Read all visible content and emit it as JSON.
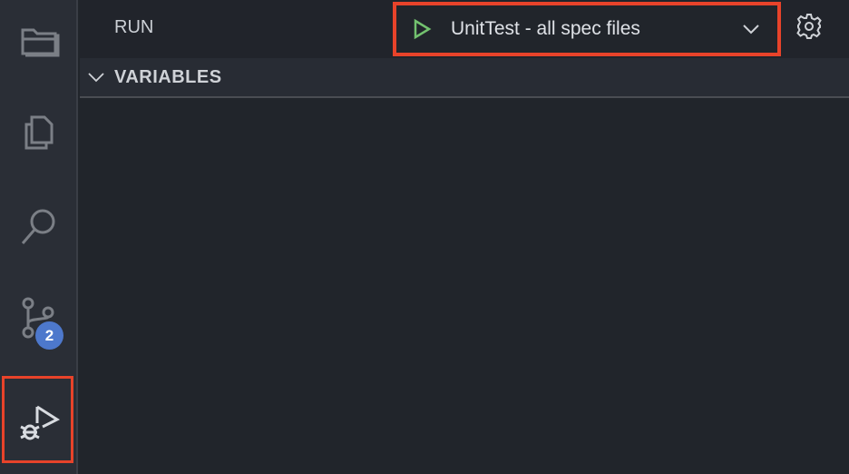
{
  "activity_bar": {
    "items": [
      "explorer",
      "search-files",
      "search",
      "source-control",
      "run-debug"
    ],
    "source_control_badge": "2"
  },
  "header": {
    "title": "RUN",
    "config_selected": "UnitTest - all spec files"
  },
  "sections": {
    "variables": "VARIABLES"
  },
  "colors": {
    "accent_highlight": "#e8432a",
    "play": "#73c26f",
    "badge": "#4d78cc"
  }
}
